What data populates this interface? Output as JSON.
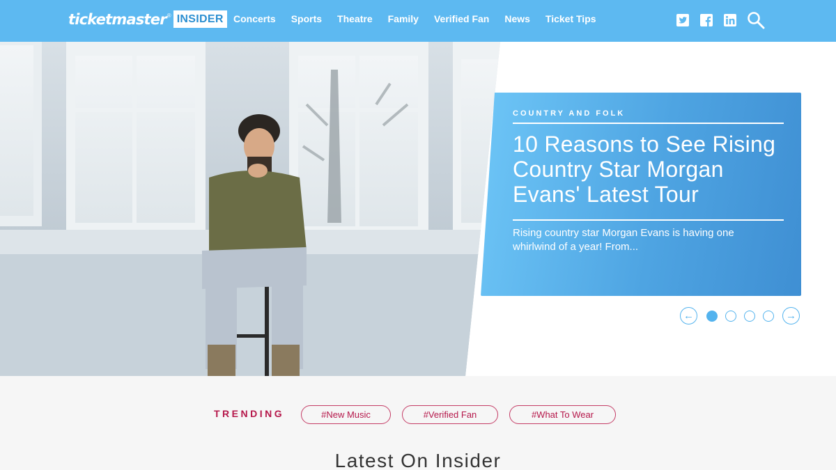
{
  "header": {
    "logo": {
      "word": "ticketmaster",
      "reg": "®",
      "badge": "INSIDER"
    },
    "nav": [
      "Concerts",
      "Sports",
      "Theatre",
      "Family",
      "Verified Fan",
      "News",
      "Ticket Tips"
    ],
    "icons": [
      "twitter-icon",
      "facebook-icon",
      "linkedin-icon",
      "search-icon"
    ],
    "bg_color": "#5db9f1"
  },
  "hero": {
    "category": "COUNTRY AND FOLK",
    "title": "10 Reasons to See Rising Country Star Morgan Evans' Latest Tour",
    "excerpt": "Rising country star Morgan Evans is having one whirlwind of a year! From...",
    "carousel": {
      "slides": 4,
      "active_index": 0,
      "prev": "←",
      "next": "→"
    }
  },
  "trending": {
    "label": "TRENDING",
    "tags": [
      "#New Music",
      "#Verified Fan",
      "#What To Wear"
    ]
  },
  "section": {
    "title": "Latest On Insider"
  },
  "colors": {
    "accent": "#53b3ee",
    "trending": "#b5174a"
  }
}
